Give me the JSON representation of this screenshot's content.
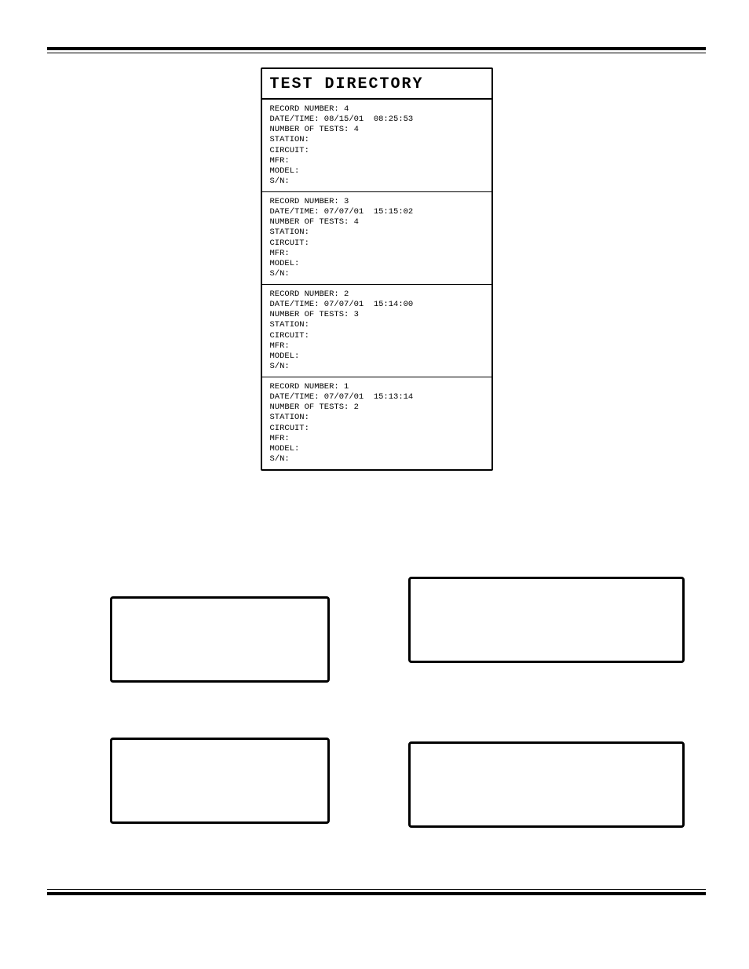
{
  "printout": {
    "title": "TEST DIRECTORY",
    "records": [
      {
        "record_number_label": "RECORD NUMBER:",
        "record_number": "4",
        "datetime_label": "DATE/TIME:",
        "date": "08/15/01",
        "time": "08:25:53",
        "tests_label": "NUMBER OF TESTS:",
        "tests": "4",
        "station_label": "STATION:",
        "station": "",
        "circuit_label": "CIRCUIT:",
        "circuit": "",
        "mfr_label": "MFR:",
        "mfr": "",
        "model_label": "MODEL:",
        "model": "",
        "sn_label": "S/N:",
        "sn": ""
      },
      {
        "record_number_label": "RECORD NUMBER:",
        "record_number": "3",
        "datetime_label": "DATE/TIME:",
        "date": "07/07/01",
        "time": "15:15:02",
        "tests_label": "NUMBER OF TESTS:",
        "tests": "4",
        "station_label": "STATION:",
        "station": "",
        "circuit_label": "CIRCUIT:",
        "circuit": "",
        "mfr_label": "MFR:",
        "mfr": "",
        "model_label": "MODEL:",
        "model": "",
        "sn_label": "S/N:",
        "sn": ""
      },
      {
        "record_number_label": "RECORD NUMBER:",
        "record_number": "2",
        "datetime_label": "DATE/TIME:",
        "date": "07/07/01",
        "time": "15:14:00",
        "tests_label": "NUMBER OF TESTS:",
        "tests": "3",
        "station_label": "STATION:",
        "station": "",
        "circuit_label": "CIRCUIT:",
        "circuit": "",
        "mfr_label": "MFR:",
        "mfr": "",
        "model_label": "MODEL:",
        "model": "",
        "sn_label": "S/N:",
        "sn": ""
      },
      {
        "record_number_label": "RECORD NUMBER:",
        "record_number": "1",
        "datetime_label": "DATE/TIME:",
        "date": "07/07/01",
        "time": "15:13:14",
        "tests_label": "NUMBER OF TESTS:",
        "tests": "2",
        "station_label": "STATION:",
        "station": "",
        "circuit_label": "CIRCUIT:",
        "circuit": "",
        "mfr_label": "MFR:",
        "mfr": "",
        "model_label": "MODEL:",
        "model": "",
        "sn_label": "S/N:",
        "sn": ""
      }
    ]
  }
}
